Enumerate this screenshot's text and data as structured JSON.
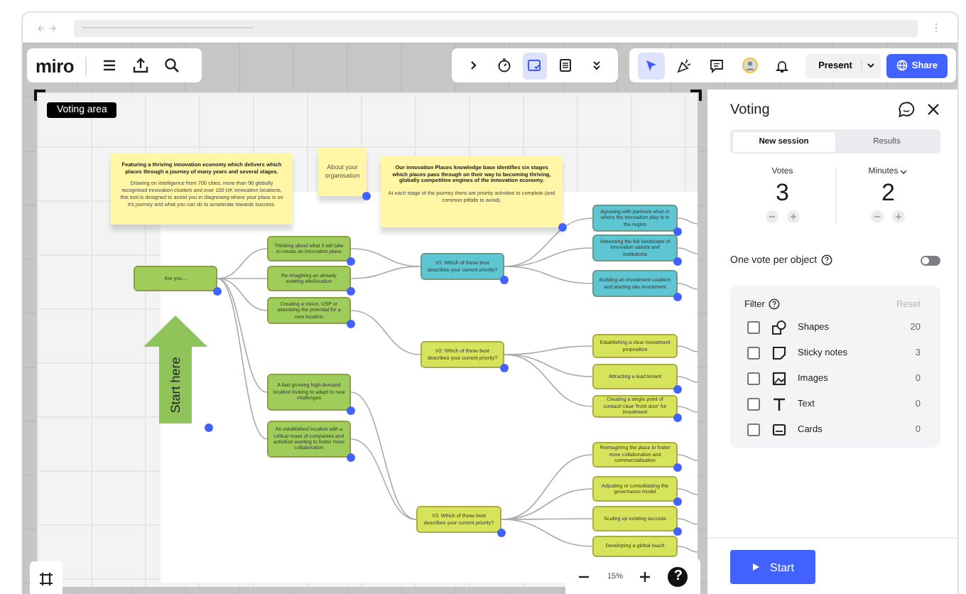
{
  "toolbar": {
    "logo": "miro",
    "left_tools": [
      {
        "kind": "menu"
      },
      {
        "kind": "upload"
      },
      {
        "kind": "search"
      }
    ],
    "center_tools": [
      {
        "kind": "chevron",
        "selected": false
      },
      {
        "kind": "timer",
        "selected": false
      },
      {
        "kind": "voting",
        "selected": true
      },
      {
        "kind": "notes",
        "selected": false
      },
      {
        "kind": "more",
        "selected": false
      }
    ],
    "right_tools": [
      {
        "kind": "cursor",
        "selected": true
      },
      {
        "kind": "reactions",
        "selected": false
      },
      {
        "kind": "comment",
        "selected": false
      },
      {
        "kind": "avatar",
        "selected": false
      },
      {
        "kind": "bell",
        "selected": false
      }
    ],
    "present_label": "Present",
    "share_label": "Share"
  },
  "board": {
    "frame_label": "Voting area",
    "stickies": [
      {
        "title": "Featuring a thriving innovation economy which delivers which places through a journey of many years and several stages.",
        "body": "Drawing on intelligence from 700 cities, more than 90 globally recognised innovation clusters and over 100 UK innovation locations, this tool is designed to assist you in diagnosing where your place is on it's journey and what you can do to accelerate towards success.",
        "selected": false
      },
      {
        "title": "About your organisation",
        "selected": true
      },
      {
        "title": "Our innovation Places knowledge base identifies six stages which places pass through on their way to becoming thriving, globally competitive engines of the innovation economy.",
        "body": "At each stage of the journey there are priority activities to complete (and common pitfalls to avoid).",
        "selected": true
      }
    ],
    "nodes": [
      {
        "text": "Are you...",
        "color": "#9fcd5c",
        "selected": true
      },
      {
        "text": "Thinking about what it will take to create an innovation place",
        "color": "#9fcd5c",
        "selected": true
      },
      {
        "text": "Re-imagining an already existing site/location",
        "color": "#9fcd5c",
        "selected": true
      },
      {
        "text": "Creating a vision, USP or assessing the potential for a new location",
        "color": "#9fcd5c",
        "selected": true
      },
      {
        "text": "A fast growing high-demand location looking to adapt to new challenges",
        "color": "#9fcd5c",
        "selected": true
      },
      {
        "text": "An established location with a critical mass of companies and activities wanting to foster more collaboration",
        "color": "#9fcd5c",
        "selected": true
      },
      {
        "text": "V1: Which of these best describes your current priority?",
        "color": "#5dc6d2",
        "selected": true
      },
      {
        "text": "V2: Which of these best describes your current priority?",
        "color": "#d6e45c",
        "selected": true
      },
      {
        "text": "V3: Which of these best describes your current priority?",
        "color": "#d6e45c",
        "selected": true
      },
      {
        "text": "Agreeing with partners what or where the innovation play is in the region",
        "color": "#5dc6d2",
        "selected": true
      },
      {
        "text": "Assessing the full landscape of innovation assets and institutions",
        "color": "#5dc6d2",
        "selected": true
      },
      {
        "text": "Building an investment coalition and starting site investment",
        "color": "#5dc6d2",
        "selected": true
      },
      {
        "text": "Establishing a clear investment proposition",
        "color": "#d6e45c",
        "selected": false
      },
      {
        "text": "Attracting a lead tenant",
        "color": "#d6e45c",
        "selected": true
      },
      {
        "text": "Creating a single point of contact/ clear 'front door' for investment",
        "color": "#d6e45c",
        "selected": true
      },
      {
        "text": "Reimagining the place to foster more collaboration and commercialisation",
        "color": "#d6e45c",
        "selected": true
      },
      {
        "text": "Adjusting or consolidating the governance model",
        "color": "#d6e45c",
        "selected": true
      },
      {
        "text": "Scaling up existing success",
        "color": "#d6e45c",
        "selected": true
      },
      {
        "text": "Developing a global reach",
        "color": "#d6e45c",
        "selected": false
      }
    ],
    "start_arrow": {
      "label": "Start here",
      "selected": true
    }
  },
  "zoom": {
    "level_text": "15%",
    "help_label": "?"
  },
  "panel": {
    "title": "Voting",
    "tabs": [
      {
        "label": "New session",
        "selected": true
      },
      {
        "label": "Results",
        "selected": false
      }
    ],
    "counters": [
      {
        "label": "Votes",
        "value": "3",
        "dropdown": false
      },
      {
        "label": "Minutes",
        "value": "2",
        "dropdown": true
      }
    ],
    "one_vote": {
      "label": "One vote per object",
      "on": false
    },
    "filter": {
      "title": "Filter",
      "reset_label": "Reset",
      "reset_disabled": true,
      "items": [
        {
          "kind": "shapes",
          "label": "Shapes",
          "count": "20",
          "checked": false
        },
        {
          "kind": "sticky",
          "label": "Sticky notes",
          "count": "3",
          "checked": false
        },
        {
          "kind": "images",
          "label": "Images",
          "count": "0",
          "checked": false
        },
        {
          "kind": "text",
          "label": "Text",
          "count": "0",
          "checked": false
        },
        {
          "kind": "cards",
          "label": "Cards",
          "count": "0",
          "checked": false
        }
      ]
    },
    "start_label": "Start"
  }
}
